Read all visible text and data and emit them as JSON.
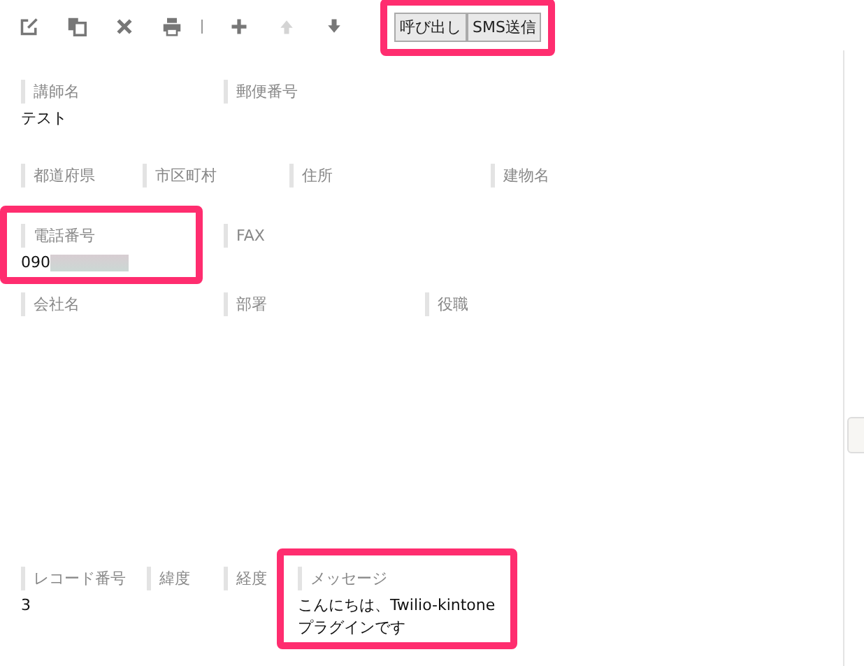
{
  "toolbar": {
    "tools": [
      {
        "kind": "edit",
        "disabled": false
      },
      {
        "kind": "copy",
        "disabled": false
      },
      {
        "kind": "delete",
        "disabled": false
      },
      {
        "kind": "print",
        "disabled": false
      },
      {
        "kind": "separator"
      },
      {
        "kind": "add",
        "disabled": false
      },
      {
        "kind": "up",
        "disabled": true
      },
      {
        "kind": "down",
        "disabled": false
      }
    ],
    "buttons": {
      "highlighted": true,
      "items": [
        "呼び出し",
        "SMS送信"
      ]
    }
  },
  "rows": [
    {
      "fields": [
        {
          "label": "講師名",
          "value": "テスト",
          "highlighted": false
        },
        {
          "label": "郵便番号",
          "highlighted": false
        }
      ]
    },
    {
      "fields": [
        {
          "label": "都道府県",
          "highlighted": false
        },
        {
          "label": "市区町村",
          "highlighted": false
        },
        {
          "label": "住所",
          "highlighted": false
        },
        {
          "label": "建物名",
          "highlighted": false
        }
      ]
    },
    {
      "fields": [
        {
          "label": "電話番号",
          "value": "090",
          "redacted": true,
          "highlighted": true
        },
        {
          "label": "FAX",
          "highlighted": false
        }
      ]
    },
    {
      "fields": [
        {
          "label": "会社名",
          "highlighted": false
        },
        {
          "label": "部署",
          "highlighted": false
        },
        {
          "label": "役職",
          "highlighted": false
        }
      ]
    },
    {
      "fields": [
        {
          "label": "レコード番号",
          "value": "3",
          "highlighted": false
        },
        {
          "label": "緯度",
          "highlighted": false
        },
        {
          "label": "経度",
          "highlighted": false
        },
        {
          "label": "メッセージ",
          "value": "こんにちは、Twilio-kintoneプラグインです",
          "highlighted": true
        }
      ]
    }
  ]
}
